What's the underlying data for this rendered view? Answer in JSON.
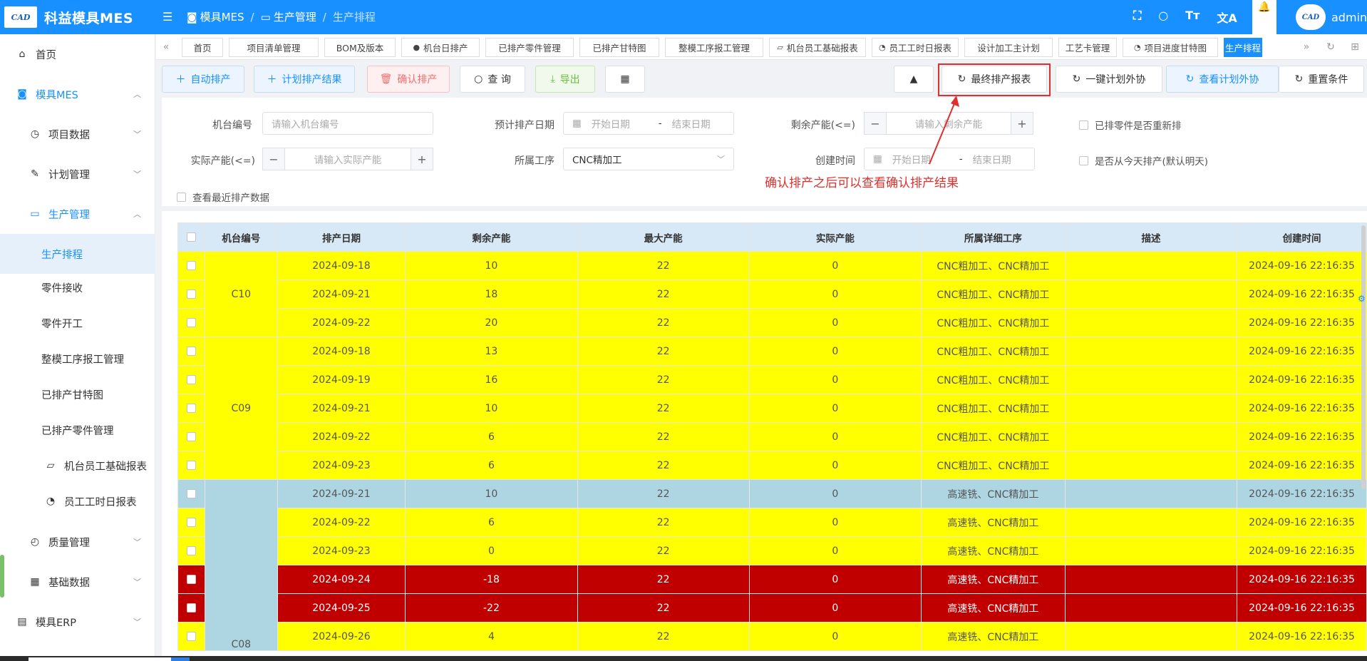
{
  "app": {
    "title": "科益模具MES",
    "logo_mark": "CAD"
  },
  "header": {
    "crumb1": "模具MES",
    "crumb2": "生产管理",
    "crumb3": "生产排程",
    "icons": [
      "fullscreen-icon",
      "search-icon",
      "font-size-icon",
      "translate-icon",
      "bell-icon"
    ],
    "user": "admin",
    "avatar_text": "CAD"
  },
  "sidebar": {
    "items": [
      {
        "label": "首页",
        "icon": "home-icon"
      },
      {
        "label": "模具MES",
        "icon": "camera-icon"
      },
      {
        "label": "项目数据",
        "icon": "clock-icon"
      },
      {
        "label": "计划管理",
        "icon": "edit-icon"
      },
      {
        "label": "生产管理",
        "icon": "printer-icon"
      },
      {
        "label": "生产排程"
      },
      {
        "label": "零件接收"
      },
      {
        "label": "零件开工"
      },
      {
        "label": "整模工序报工管理"
      },
      {
        "label": "已排产甘特图"
      },
      {
        "label": "已排产零件管理"
      },
      {
        "label": "机台员工基础报表",
        "icon": "monitor-icon"
      },
      {
        "label": "员工工时日报表",
        "icon": "time-icon"
      },
      {
        "label": "质量管理",
        "icon": "timer-icon"
      },
      {
        "label": "基础数据",
        "icon": "calendar-icon"
      },
      {
        "label": "模具ERP",
        "icon": "book-icon"
      }
    ]
  },
  "tabs": [
    "首页",
    "项目清单管理",
    "BOM及版本",
    "机台日排产",
    "已排产零件管理",
    "已排产甘特图",
    "整模工序报工管理",
    "机台员工基础报表",
    "员工工时日报表",
    "设计加工主计划",
    "工艺卡管理",
    "项目进度甘特图",
    "生产排程"
  ],
  "toolbar": {
    "auto_schedule": "自动排产",
    "plan_result": "计划排产结果",
    "confirm": "确认排产",
    "query": "查 询",
    "export": "导出",
    "final_report": "最终排产报表",
    "outsource": "一键计划外协",
    "view_outsource": "查看计划外协",
    "reset": "重置条件"
  },
  "filter": {
    "machine_label": "机台编号",
    "machine_placeholder": "请输入机台编号",
    "plan_date_label": "预计排产日期",
    "start_date": "开始日期",
    "date_sep": "-",
    "end_date": "结束日期",
    "remain_label": "剩余产能(<=)",
    "remain_placeholder": "请输入剩余产能",
    "rescheduled_label": "已排零件是否重新排",
    "actual_label": "实际产能(<=)",
    "actual_placeholder": "请输入实际产能",
    "process_label": "所属工序",
    "process_value": "CNC精加工",
    "created_label": "创建时间",
    "today_label": "是否从今天排产(默认明天)",
    "recent_label": "查看最近排产数据",
    "minus": "−",
    "plus": "+"
  },
  "annotation": "确认排产之后可以查看确认排产结果",
  "table": {
    "headers": [
      "机台编号",
      "排产日期",
      "剩余产能",
      "最大产能",
      "实际产能",
      "所属详细工序",
      "描述",
      "创建时间"
    ],
    "groups": [
      {
        "machine": "C10",
        "rows": 3
      },
      {
        "machine": "C09",
        "rows": 5
      },
      {
        "machine": "C08",
        "rows": 6
      }
    ],
    "rows": [
      {
        "color": "yellow",
        "date": "2024-09-18",
        "remain": "10",
        "max": "22",
        "actual": "0",
        "process": "CNC粗加工、CNC精加工",
        "desc": "",
        "created": "2024-09-16 22:16:35"
      },
      {
        "color": "yellow",
        "date": "2024-09-21",
        "remain": "18",
        "max": "22",
        "actual": "0",
        "process": "CNC粗加工、CNC精加工",
        "desc": "",
        "created": "2024-09-16 22:16:35"
      },
      {
        "color": "yellow",
        "date": "2024-09-22",
        "remain": "20",
        "max": "22",
        "actual": "0",
        "process": "CNC粗加工、CNC精加工",
        "desc": "",
        "created": "2024-09-16 22:16:35"
      },
      {
        "color": "yellow",
        "date": "2024-09-18",
        "remain": "13",
        "max": "22",
        "actual": "0",
        "process": "CNC粗加工、CNC精加工",
        "desc": "",
        "created": "2024-09-16 22:16:35"
      },
      {
        "color": "yellow",
        "date": "2024-09-19",
        "remain": "16",
        "max": "22",
        "actual": "0",
        "process": "CNC粗加工、CNC精加工",
        "desc": "",
        "created": "2024-09-16 22:16:35"
      },
      {
        "color": "yellow",
        "date": "2024-09-21",
        "remain": "10",
        "max": "22",
        "actual": "0",
        "process": "CNC粗加工、CNC精加工",
        "desc": "",
        "created": "2024-09-16 22:16:35"
      },
      {
        "color": "yellow",
        "date": "2024-09-22",
        "remain": "6",
        "max": "22",
        "actual": "0",
        "process": "CNC粗加工、CNC精加工",
        "desc": "",
        "created": "2024-09-16 22:16:35"
      },
      {
        "color": "yellow",
        "date": "2024-09-23",
        "remain": "6",
        "max": "22",
        "actual": "0",
        "process": "CNC粗加工、CNC精加工",
        "desc": "",
        "created": "2024-09-16 22:16:35"
      },
      {
        "color": "blue",
        "date": "2024-09-21",
        "remain": "10",
        "max": "22",
        "actual": "0",
        "process": "高速铣、CNC精加工",
        "desc": "",
        "created": "2024-09-16 22:16:35"
      },
      {
        "color": "yellow",
        "date": "2024-09-22",
        "remain": "6",
        "max": "22",
        "actual": "0",
        "process": "高速铣、CNC精加工",
        "desc": "",
        "created": "2024-09-16 22:16:35"
      },
      {
        "color": "yellow",
        "date": "2024-09-23",
        "remain": "0",
        "max": "22",
        "actual": "0",
        "process": "高速铣、CNC精加工",
        "desc": "",
        "created": "2024-09-16 22:16:35"
      },
      {
        "color": "red",
        "date": "2024-09-24",
        "remain": "-18",
        "max": "22",
        "actual": "0",
        "process": "高速铣、CNC精加工",
        "desc": "",
        "created": "2024-09-16 22:16:35"
      },
      {
        "color": "red",
        "date": "2024-09-25",
        "remain": "-22",
        "max": "22",
        "actual": "0",
        "process": "高速铣、CNC精加工",
        "desc": "",
        "created": "2024-09-16 22:16:35"
      },
      {
        "color": "yellow",
        "date": "2024-09-26",
        "remain": "4",
        "max": "22",
        "actual": "0",
        "process": "高速铣、CNC精加工",
        "desc": "",
        "created": "2024-09-16 22:16:35"
      }
    ]
  },
  "colors": {
    "primary": "#1890ff",
    "row_yellow": "#ffff00",
    "row_blue": "#aed6e2",
    "row_red": "#c00000",
    "annotation": "#e0302e"
  }
}
